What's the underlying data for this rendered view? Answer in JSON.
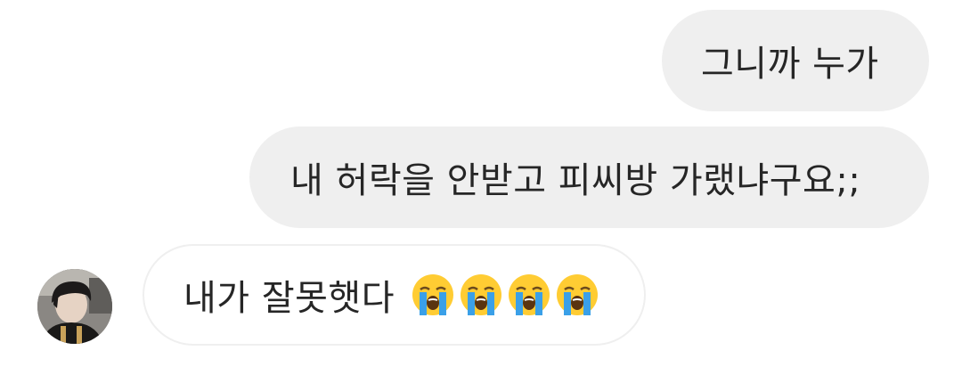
{
  "conversation": {
    "messages": [
      {
        "sender": "me",
        "text": "그니까 누가"
      },
      {
        "sender": "me",
        "text": "내 허락을 안받고 피씨방 가랬냐구요;;"
      },
      {
        "sender": "other",
        "text": "내가 잘못햇다",
        "emoji": [
          "loudly-crying-face",
          "loudly-crying-face",
          "loudly-crying-face",
          "loudly-crying-face"
        ]
      }
    ]
  },
  "colors": {
    "sent_bubble": "#efefef",
    "received_border": "#efefef",
    "text": "#262626",
    "background": "#ffffff"
  }
}
